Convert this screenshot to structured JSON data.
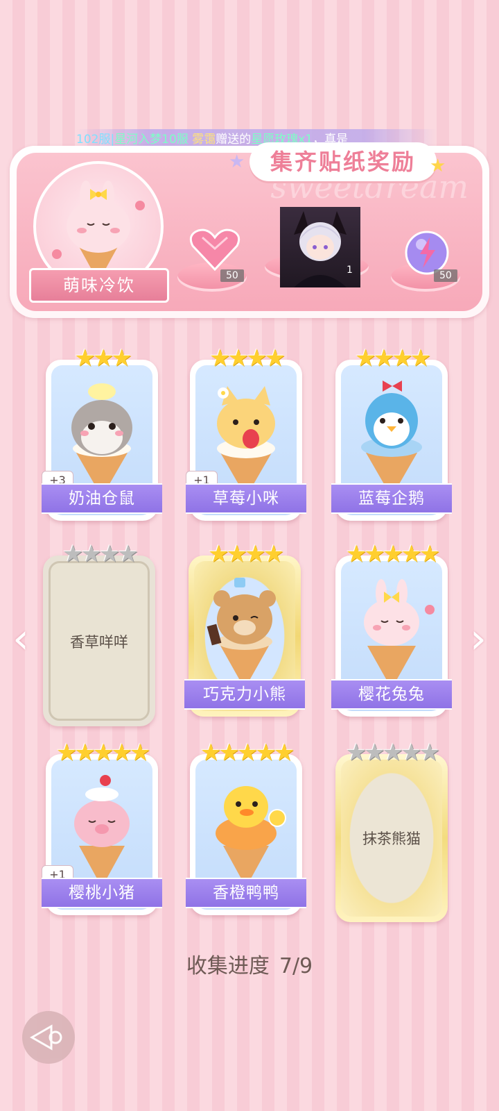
{
  "marquee": {
    "server": "102服",
    "sep1": "|",
    "player": "星河入梦10服",
    "name": "雾霭",
    "verb": "赠送的",
    "item": "星愿玫瑰x1",
    "tail": "，真是"
  },
  "banner": {
    "title": "集齐贴纸奖励",
    "watermark": "sweetdream",
    "badge_label": "萌味冷饮",
    "rewards": [
      {
        "name": "heart-gem-icon",
        "count": "50"
      },
      {
        "name": "character-portrait",
        "count": "1"
      },
      {
        "name": "energy-orb-icon",
        "count": "50"
      }
    ]
  },
  "cards": [
    {
      "label": "奶油仓鼠",
      "stars": 3,
      "max_stars": 3,
      "plus": "+3",
      "state": "owned"
    },
    {
      "label": "草莓小咪",
      "stars": 4,
      "max_stars": 4,
      "plus": "+1",
      "state": "owned"
    },
    {
      "label": "蓝莓企鹅",
      "stars": 4,
      "max_stars": 4,
      "plus": "",
      "state": "owned"
    },
    {
      "label": "香草咩咩",
      "stars": 0,
      "max_stars": 4,
      "plus": "",
      "state": "locked"
    },
    {
      "label": "巧克力小熊",
      "stars": 4,
      "max_stars": 4,
      "plus": "",
      "state": "gold"
    },
    {
      "label": "樱花兔兔",
      "stars": 5,
      "max_stars": 5,
      "plus": "",
      "state": "owned"
    },
    {
      "label": "樱桃小猪",
      "stars": 5,
      "max_stars": 5,
      "plus": "+1",
      "state": "owned"
    },
    {
      "label": "香橙鸭鸭",
      "stars": 5,
      "max_stars": 5,
      "plus": "",
      "state": "owned"
    },
    {
      "label": "抹茶熊猫",
      "stars": 0,
      "max_stars": 5,
      "plus": "",
      "state": "gold-locked"
    }
  ],
  "progress": {
    "label": "收集进度",
    "value": "7/9"
  },
  "nav": {
    "prev": "‹",
    "next": "›"
  }
}
